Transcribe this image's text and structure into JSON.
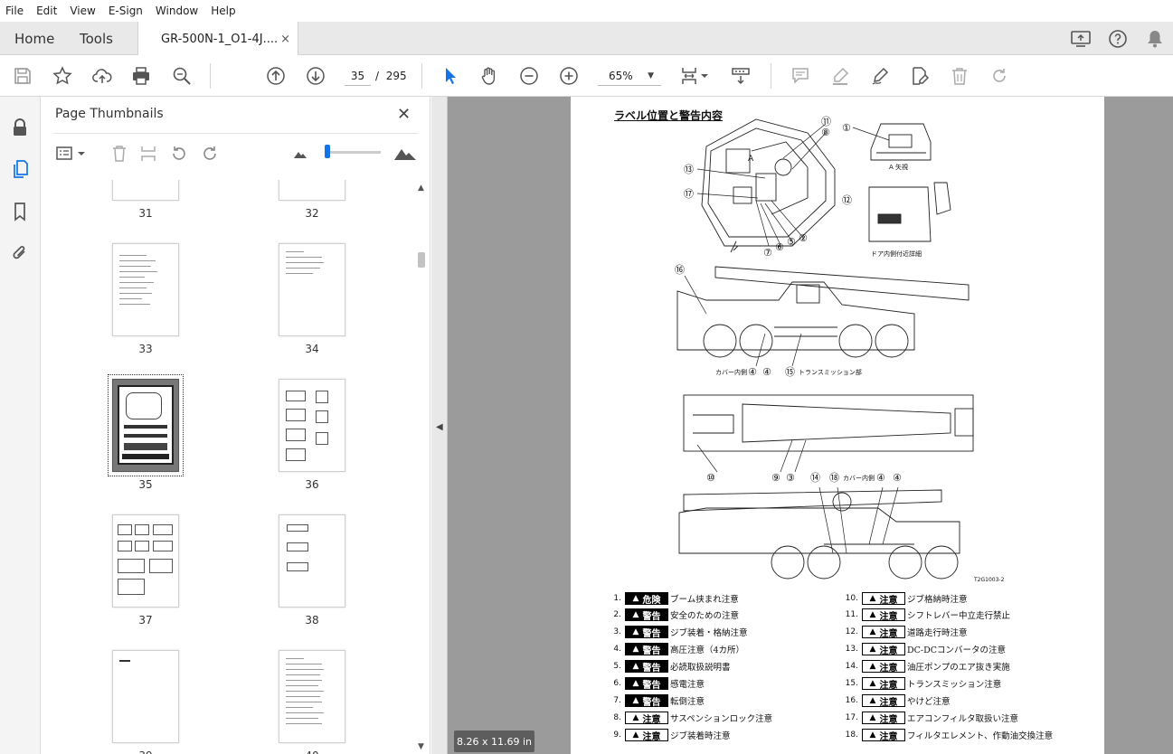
{
  "menu": [
    "File",
    "Edit",
    "View",
    "E-Sign",
    "Window",
    "Help"
  ],
  "tabs": {
    "home": "Home",
    "tools": "Tools",
    "document": "GR-500N-1_O1-4J....",
    "close": "×"
  },
  "toolbar": {
    "current_page": "35",
    "page_sep": "/",
    "total_pages": "295",
    "zoom": "65%",
    "zoom_dd": "▼"
  },
  "panel": {
    "title": "Page Thumbnails",
    "close": "✕"
  },
  "thumbnails": [
    {
      "num": "31"
    },
    {
      "num": "32"
    },
    {
      "num": "33"
    },
    {
      "num": "34"
    },
    {
      "num": "35"
    },
    {
      "num": "36"
    },
    {
      "num": "37"
    },
    {
      "num": "38"
    },
    {
      "num": "39"
    },
    {
      "num": "40"
    }
  ],
  "document": {
    "heading": "ラベル位置と警告内容",
    "diagram_labels": {
      "a_view": "A 矢視",
      "door": "ドア内側付近詳細",
      "cover1": "カバー内側",
      "trans": "トランスミッション部",
      "cover2": "カバー内側",
      "figno": "T2G1003-2",
      "letter_a": "A"
    },
    "legend_left": [
      {
        "n": "1.",
        "kind": "danger",
        "badge": "危険",
        "text": "ブーム挟まれ注意"
      },
      {
        "n": "2.",
        "kind": "warning",
        "badge": "警告",
        "text": "安全のための注意"
      },
      {
        "n": "3.",
        "kind": "warning",
        "badge": "警告",
        "text": "ジブ装着・格納注意"
      },
      {
        "n": "4.",
        "kind": "warning",
        "badge": "警告",
        "text": "高圧注意（4カ所）"
      },
      {
        "n": "5.",
        "kind": "warning",
        "badge": "警告",
        "text": "必読取扱説明書"
      },
      {
        "n": "6.",
        "kind": "warning",
        "badge": "警告",
        "text": "感電注意"
      },
      {
        "n": "7.",
        "kind": "warning",
        "badge": "警告",
        "text": "転倒注意"
      },
      {
        "n": "8.",
        "kind": "caution",
        "badge": "注意",
        "text": "サスペンションロック注意"
      },
      {
        "n": "9.",
        "kind": "caution",
        "badge": "注意",
        "text": "ジブ装着時注意"
      }
    ],
    "legend_right": [
      {
        "n": "10.",
        "kind": "caution",
        "badge": "注意",
        "text": "ジブ格納時注意"
      },
      {
        "n": "11.",
        "kind": "caution",
        "badge": "注意",
        "text": "シフトレバー中立走行禁止"
      },
      {
        "n": "12.",
        "kind": "caution",
        "badge": "注意",
        "text": "道路走行時注意"
      },
      {
        "n": "13.",
        "kind": "caution",
        "badge": "注意",
        "text": "DC-DCコンバータの注意"
      },
      {
        "n": "14.",
        "kind": "caution",
        "badge": "注意",
        "text": "油圧ポンプのエア抜き実施"
      },
      {
        "n": "15.",
        "kind": "caution",
        "badge": "注意",
        "text": "トランスミッション注意"
      },
      {
        "n": "16.",
        "kind": "caution",
        "badge": "注意",
        "text": "やけど注意"
      },
      {
        "n": "17.",
        "kind": "caution",
        "badge": "注意",
        "text": "エアコンフィルタ取扱い注意"
      },
      {
        "n": "18.",
        "kind": "caution",
        "badge": "注意",
        "text": "フィルタエレメント、作動油交換注意"
      }
    ],
    "callouts": {
      "c1": "①",
      "c2": "②",
      "c3": "③",
      "c4": "④",
      "c5": "⑤",
      "c6": "⑥",
      "c7": "⑦",
      "c8": "⑧",
      "c9": "⑨",
      "c10": "⑩",
      "c11": "⑪",
      "c12": "⑫",
      "c13": "⑬",
      "c14": "⑭",
      "c15": "⑮",
      "c16": "⑯",
      "c17": "⑰",
      "c18": "⑱"
    }
  },
  "status": {
    "page_size": "8.26 x 11.69 in"
  },
  "colors": {
    "accent": "#1473e6",
    "doc_bg": "#9b9b9b",
    "tab_bg": "#e9e9e9"
  }
}
